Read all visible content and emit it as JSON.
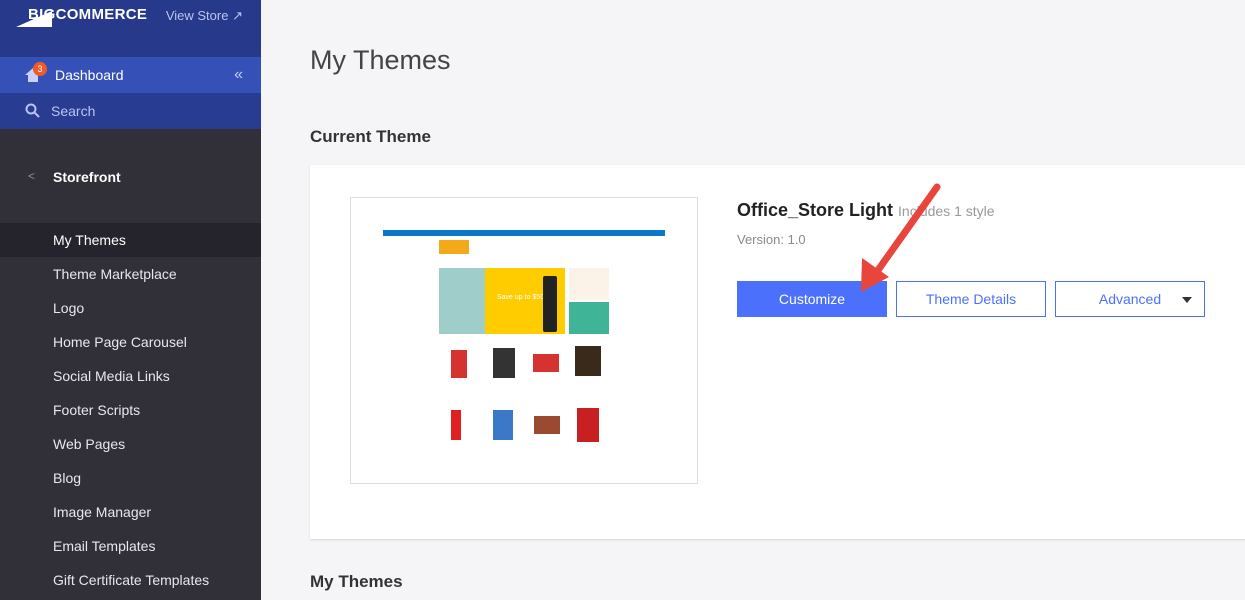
{
  "sidebar": {
    "logo": "BIGCOMMERCE",
    "view_store": "View Store",
    "dashboard": "Dashboard",
    "badge": "3",
    "search": "Search",
    "section": "Storefront",
    "items": [
      {
        "label": "My Themes",
        "active": true
      },
      {
        "label": "Theme Marketplace"
      },
      {
        "label": "Logo"
      },
      {
        "label": "Home Page Carousel"
      },
      {
        "label": "Social Media Links"
      },
      {
        "label": "Footer Scripts"
      },
      {
        "label": "Web Pages"
      },
      {
        "label": "Blog"
      },
      {
        "label": "Image Manager"
      },
      {
        "label": "Email Templates"
      },
      {
        "label": "Gift Certificate Templates"
      }
    ]
  },
  "main": {
    "title": "My Themes",
    "current_theme_heading": "Current Theme",
    "theme": {
      "name": "Office_Store Light",
      "styles": "Includes 1 style",
      "version": "Version: 1.0",
      "preview_banner": "Save up to $50"
    },
    "buttons": {
      "customize": "Customize",
      "details": "Theme Details",
      "advanced": "Advanced"
    },
    "my_themes_heading": "My Themes"
  },
  "colors": {
    "accent": "#4b71fc",
    "sidebar_top": "#26398a",
    "sidebar_dark": "#312f38",
    "annotation_arrow": "#e8453c"
  }
}
